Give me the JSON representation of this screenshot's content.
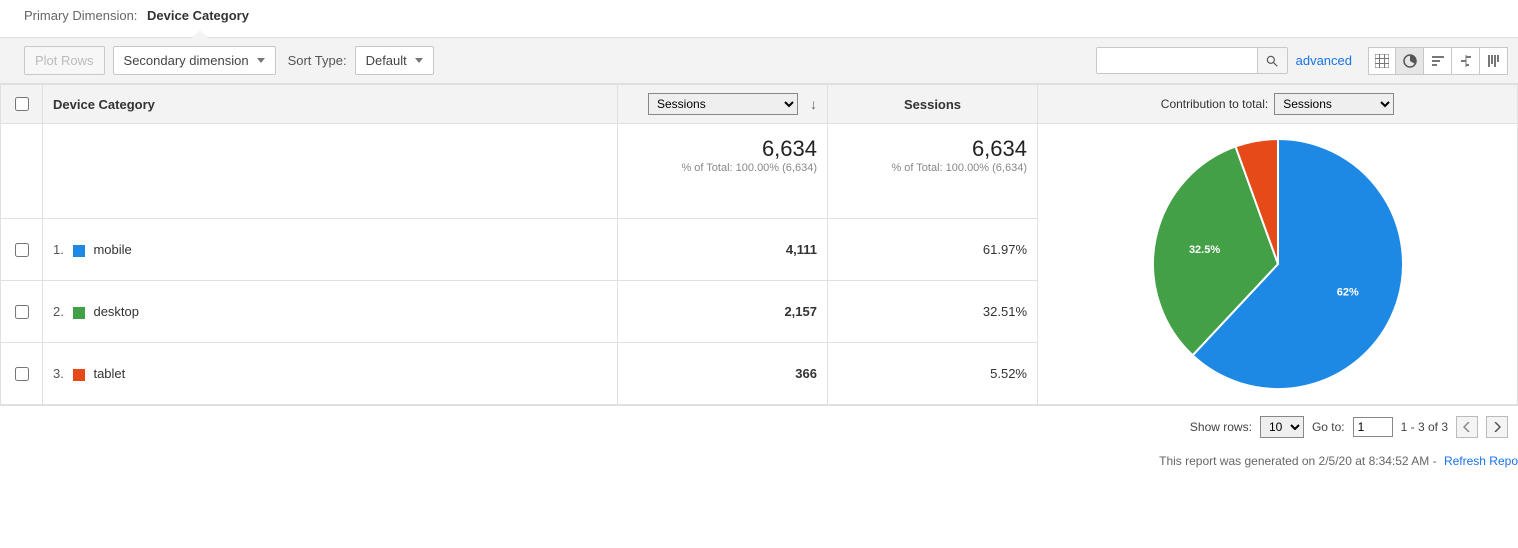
{
  "primaryDimension": {
    "label": "Primary Dimension:",
    "value": "Device Category"
  },
  "toolbar": {
    "plotRows": "Plot Rows",
    "secondaryDimension": "Secondary dimension",
    "sortTypeLabel": "Sort Type:",
    "sortTypeValue": "Default",
    "advanced": "advanced"
  },
  "columns": {
    "deviceCategory": "Device Category",
    "metricSelector": "Sessions",
    "sessions": "Sessions",
    "contributionLabel": "Contribution to total:",
    "contributionMetric": "Sessions"
  },
  "totals": {
    "sessions": "6,634",
    "sessionsSub": "% of Total: 100.00% (6,634)",
    "sessions2": "6,634",
    "sessions2Sub": "% of Total: 100.00% (6,634)"
  },
  "rows": [
    {
      "rank": "1.",
      "color": "#1E88E5",
      "label": "mobile",
      "sessions": "4,111",
      "pct": "61.97%"
    },
    {
      "rank": "2.",
      "color": "#43A047",
      "label": "desktop",
      "sessions": "2,157",
      "pct": "32.51%"
    },
    {
      "rank": "3.",
      "color": "#E64A19",
      "label": "tablet",
      "sessions": "366",
      "pct": "5.52%"
    }
  ],
  "chart_data": {
    "type": "pie",
    "title": "",
    "series": [
      {
        "name": "mobile",
        "value": 61.97,
        "color": "#1E88E5",
        "label": "62%"
      },
      {
        "name": "desktop",
        "value": 32.51,
        "color": "#43A047",
        "label": "32.5%"
      },
      {
        "name": "tablet",
        "value": 5.52,
        "color": "#E64A19",
        "label": ""
      }
    ]
  },
  "footer": {
    "showRowsLabel": "Show rows:",
    "showRowsValue": "10",
    "goToLabel": "Go to:",
    "goToValue": "1",
    "range": "1 - 3 of 3",
    "generated": "This report was generated on 2/5/20 at 8:34:52 AM - ",
    "refresh": "Refresh Repo"
  }
}
